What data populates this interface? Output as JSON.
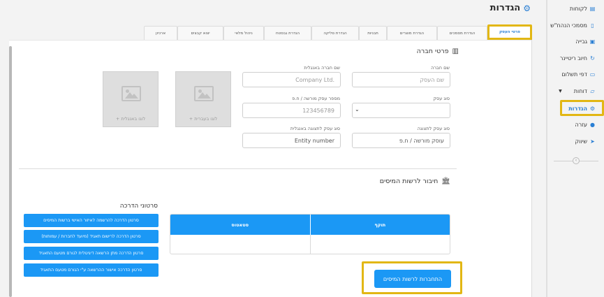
{
  "page": {
    "title": "הגדרות",
    "gear_icon": "gear-icon"
  },
  "sidebar": {
    "items": [
      {
        "label": "לקוחות",
        "icon": "document-icon"
      },
      {
        "label": "מסמכי הנהח\"ש",
        "icon": "file-icon"
      },
      {
        "label": "גבייה",
        "icon": "wallet-icon"
      },
      {
        "label": "חיוב ריטיינר",
        "icon": "refresh-icon"
      },
      {
        "label": "דפי תשלום",
        "icon": "credit-card-icon"
      },
      {
        "label": "דוחות",
        "icon": "folder-icon"
      },
      {
        "label": "הגדרות",
        "icon": "gear-icon"
      },
      {
        "label": "עזרה",
        "icon": "question-icon"
      },
      {
        "label": "שיווק",
        "icon": "send-icon"
      }
    ],
    "collapse_glyph": "‹"
  },
  "tabs": [
    {
      "label": "פרטי העסק"
    },
    {
      "label": "הגדרת מסמכים"
    },
    {
      "label": "הגדרת מוצרים"
    },
    {
      "label": "תבניות"
    },
    {
      "label": "הגדרת סליקה"
    },
    {
      "label": "הגדרת גבסטח"
    },
    {
      "label": "ניהול מלאי"
    },
    {
      "label": "יצוא קבצים"
    },
    {
      "label": "ארכיון"
    }
  ],
  "company": {
    "section_title": "פרטי חברה",
    "name_label": "שם חברה",
    "name_placeholder": "שם העסק",
    "name_en_label": "שם חברה באנגלית",
    "name_en_placeholder": "Company Ltd.",
    "type_label": "סוג עסק",
    "type_value": "",
    "reg_label": "מספר עסק מורשה / ח.פ",
    "reg_placeholder": "123456789",
    "type_display_label": "סוג עסק לתצוגה",
    "type_display_placeholder": "עוסק מורשה / ח.פ",
    "type_display_en_label": "סוג עסק לתצוגה באנגלית",
    "type_display_en_placeholder": "Entity number",
    "logo_he_caption": "+ לוגו בעברית",
    "logo_en_caption": "+ לוגו באנגלית"
  },
  "tax": {
    "section_title": "חיבור לרשות המיסים",
    "table_headers": [
      "תוקף",
      "סטאטוס"
    ],
    "table_rows": [
      [
        "",
        ""
      ]
    ],
    "guides_title": "סרטוני הדרכה",
    "guides": [
      "סרטון הדרכה להרשמה לאיזור האישי ברשות המיסים",
      "סרטון הדרכה לרישום תאגיד (מיועד לחברות / עמותות)",
      "סרטון הדרכה מתן הרשאה דיגיטלית לגורם מטעם התאגיד",
      "סרטון הדרכה אישור ההרשאה ע\"י הגורם מטעם התאגיד"
    ],
    "connect_button": "התחברות לרשות המיסים"
  }
}
